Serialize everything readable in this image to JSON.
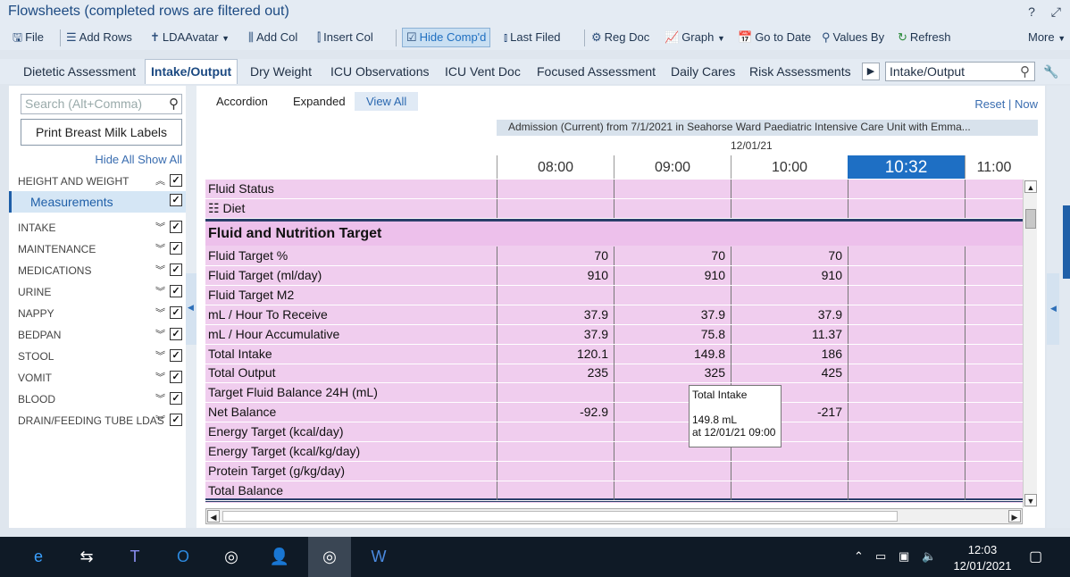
{
  "window": {
    "title": "Flowsheets (completed rows are filtered out)",
    "help_icon": "help-icon",
    "popout_icon": "popout-icon"
  },
  "toolbar": {
    "file": "File",
    "add_rows": "Add Rows",
    "lda_avatar": "LDAAvatar",
    "add_col": "Add Col",
    "insert_col": "Insert Col",
    "hide_compd": "Hide Comp'd",
    "last_filed": "Last Filed",
    "reg_doc": "Reg Doc",
    "graph": "Graph",
    "go_to_date": "Go to Date",
    "values_by": "Values By",
    "refresh": "Refresh",
    "more": "More"
  },
  "tabs": [
    "Dietetic Assessment",
    "Intake/Output",
    "Dry Weight",
    "ICU Observations",
    "ICU Vent Doc",
    "Focused Assessment",
    "Daily Cares",
    "Risk Assessments"
  ],
  "tab_search_value": "Intake/Output",
  "left": {
    "search_placeholder": "Search (Alt+Comma)",
    "print_button": "Print Breast Milk Labels",
    "hide_all": "Hide All",
    "show_all": "Show All",
    "groups": [
      "HEIGHT AND WEIGHT",
      "Measurements",
      "INTAKE",
      "MAINTENANCE",
      "MEDICATIONS",
      "URINE",
      "NAPPY",
      "BEDPAN",
      "STOOL",
      "VOMIT",
      "BLOOD",
      "DRAIN/FEEDING TUBE LDAS"
    ]
  },
  "view": {
    "accordion": "Accordion",
    "expanded": "Expanded",
    "view_all": "View All",
    "reset": "Reset",
    "now": "Now"
  },
  "admission": "Admission (Current) from 7/1/2021 in Seahorse Ward Paediatric Intensive Care Unit with Emma...",
  "date": "12/01/21",
  "times": [
    "08:00",
    "09:00",
    "10:00",
    "10:32",
    "11:00"
  ],
  "rows_top": [
    {
      "name": "Fluid Status",
      "vals": [
        "",
        "",
        "",
        "",
        ""
      ]
    },
    {
      "name": "Diet",
      "vals": [
        "",
        "",
        "",
        "",
        ""
      ]
    }
  ],
  "section_title": "Fluid and Nutrition Target",
  "rows": [
    {
      "name": "Fluid Target %",
      "vals": [
        "70",
        "70",
        "70",
        "",
        ""
      ]
    },
    {
      "name": "Fluid Target (ml/day)",
      "vals": [
        "910",
        "910",
        "910",
        "",
        ""
      ]
    },
    {
      "name": "Fluid Target M2",
      "vals": [
        "",
        "",
        "",
        "",
        ""
      ]
    },
    {
      "name": "mL / Hour To Receive",
      "vals": [
        "37.9",
        "37.9",
        "37.9",
        "",
        ""
      ]
    },
    {
      "name": "mL / Hour Accumulative",
      "vals": [
        "37.9",
        "75.8",
        "11.37",
        "",
        ""
      ]
    },
    {
      "name": "Total Intake",
      "vals": [
        "120.1",
        "149.8",
        "186",
        "",
        ""
      ]
    },
    {
      "name": "Total Output",
      "vals": [
        "235",
        "325",
        "425",
        "",
        ""
      ]
    },
    {
      "name": "Target Fluid Balance 24H (mL)",
      "vals": [
        "",
        "",
        "",
        "",
        ""
      ]
    },
    {
      "name": "Net Balance",
      "vals": [
        "-92.9",
        "",
        "-217",
        "",
        ""
      ]
    },
    {
      "name": "Energy Target (kcal/day)",
      "vals": [
        "",
        "",
        "",
        "",
        ""
      ]
    },
    {
      "name": "Energy Target (kcal/kg/day)",
      "vals": [
        "",
        "",
        "",
        "",
        ""
      ]
    },
    {
      "name": "Protein Target (g/kg/day)",
      "vals": [
        "",
        "",
        "",
        "",
        ""
      ]
    },
    {
      "name": "Total Balance",
      "vals": [
        "",
        "",
        "",
        "",
        ""
      ]
    }
  ],
  "tooltip": {
    "title": "Total Intake",
    "value": "149.8 mL",
    "when": "at 12/01/21 09:00"
  },
  "taskbar": {
    "time": "12:03",
    "date": "12/01/2021"
  },
  "colors": {
    "accent": "#1e6fc4",
    "row_bg": "#f0cdee",
    "section_bg": "#edc0eb"
  }
}
